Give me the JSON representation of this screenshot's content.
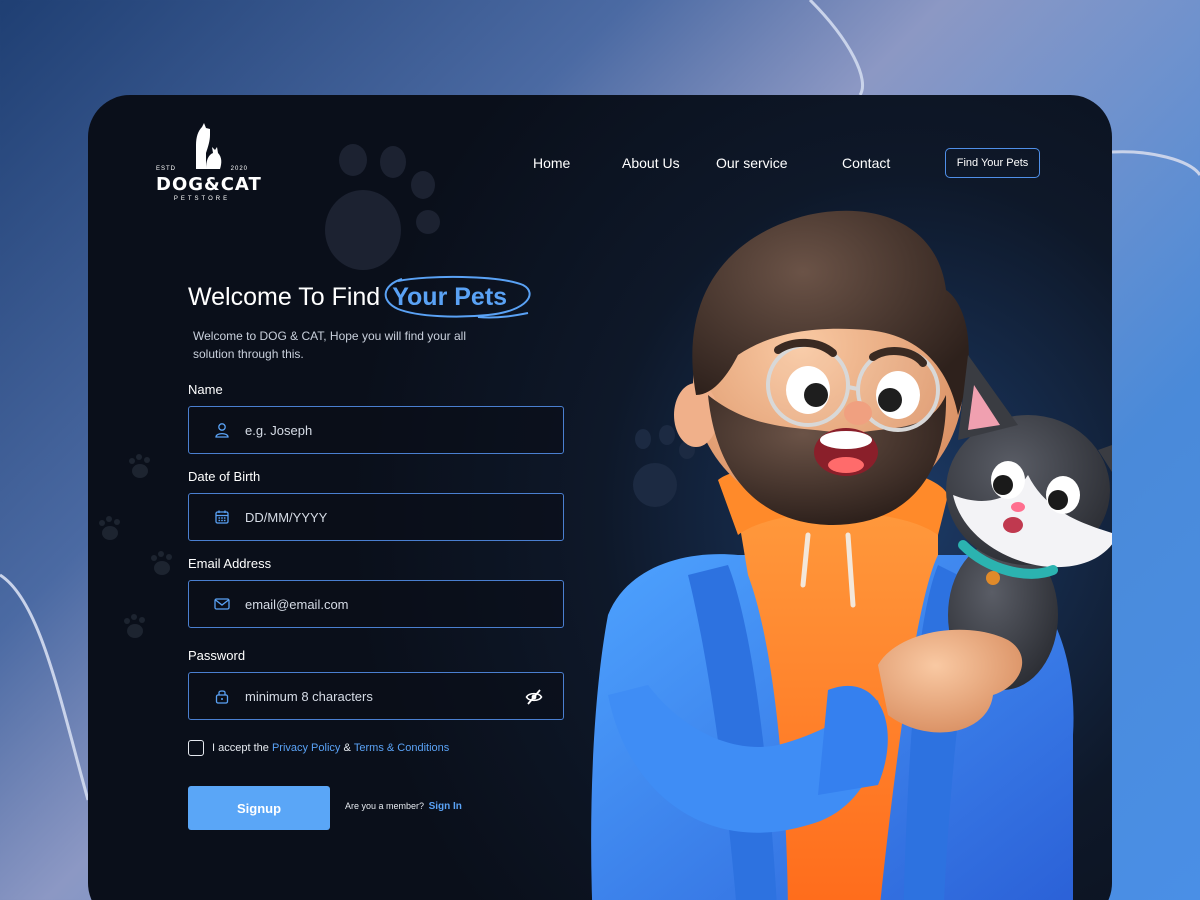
{
  "brand": {
    "estd": "ESTD",
    "year": "2020",
    "name": "DOG&CAT",
    "tagline": "PETSTORE"
  },
  "nav": {
    "items": [
      "Home",
      "About Us",
      "Our service",
      "Contact"
    ],
    "cta": "Find Your Pets"
  },
  "hero": {
    "title": "Welcome To Find",
    "title_accent": "Your Pets",
    "subtitle": "Welcome to DOG & CAT, Hope you will find your all solution through this."
  },
  "form": {
    "name": {
      "label": "Name",
      "placeholder": "e.g. Joseph",
      "icon": "user-icon"
    },
    "dob": {
      "label": "Date of Birth",
      "placeholder": "DD/MM/YYYY",
      "icon": "calendar-icon"
    },
    "email": {
      "label": "Email Address",
      "placeholder": "email@email.com",
      "icon": "mail-icon"
    },
    "password": {
      "label": "Password",
      "placeholder": "minimum 8 characters",
      "icon": "lock-icon",
      "toggle_icon": "eye-off-icon"
    },
    "terms": {
      "prefix": "I accept the",
      "privacy": "Privacy Policy",
      "amp": "&",
      "terms": "Terms & Conditions",
      "checked": false
    },
    "submit": "Signup",
    "member_text": "Are you a member?",
    "signin": "Sign In"
  },
  "colors": {
    "accent": "#5aa2f5",
    "card_bg": "#0e1829",
    "field_border": "#4a7fd0"
  }
}
